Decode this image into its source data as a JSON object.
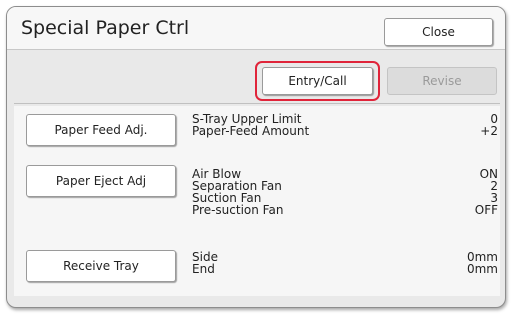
{
  "header": {
    "title": "Special Paper Ctrl",
    "close_label": "Close"
  },
  "toolbar": {
    "entry_call_label": "Entry/Call",
    "revise_label": "Revise"
  },
  "paper_feed": {
    "button_label": "Paper Feed Adj.",
    "rows": [
      {
        "label": "S-Tray Upper Limit",
        "value": "0"
      },
      {
        "label": "Paper-Feed Amount",
        "value": "+2"
      }
    ]
  },
  "paper_eject": {
    "button_label": "Paper Eject Adj",
    "rows": [
      {
        "label": "Air Blow",
        "value": "ON"
      },
      {
        "label": "Separation Fan",
        "value": "2"
      },
      {
        "label": "Suction Fan",
        "value": "3"
      },
      {
        "label": "Pre-suction Fan",
        "value": "OFF"
      }
    ]
  },
  "receive_tray": {
    "button_label": "Receive Tray",
    "rows": [
      {
        "label": "Side",
        "value": "0mm"
      },
      {
        "label": "End",
        "value": "0mm"
      }
    ]
  },
  "colors": {
    "highlight": "#e0243a",
    "panel_bg": "#e9e9e9",
    "content_bg": "#f6f6f6"
  }
}
